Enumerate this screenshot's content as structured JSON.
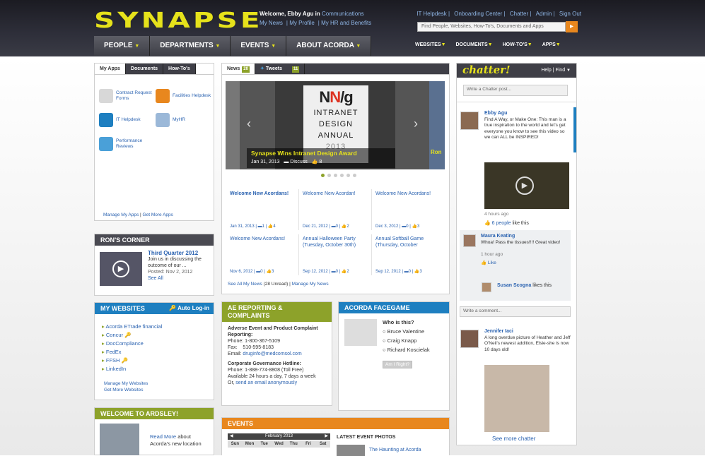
{
  "brand": {
    "logo": "SYNAPSE"
  },
  "header": {
    "welcome_prefix": "Welcome, Ebby Agu in",
    "department": "Communications",
    "user_links": [
      "My News",
      "My Profile",
      "My HR and Benefits"
    ],
    "top_links": [
      "IT Helpdesk",
      "Onboarding Center",
      "Chatter",
      "Admin",
      "Sign Out"
    ],
    "search_placeholder": "Find People, Websites, How-To's, Documents and Apps"
  },
  "main_nav": [
    "PEOPLE",
    "DEPARTMENTS",
    "EVENTS",
    "ABOUT ACORDA"
  ],
  "sub_nav": [
    "WEBSITES",
    "DOCUMENTS",
    "HOW-TO'S",
    "APPS"
  ],
  "apps": {
    "tabs": [
      "My Apps",
      "Documents",
      "How-To's"
    ],
    "items": [
      {
        "label": "Contract Request Forms",
        "icon": "contract-icon",
        "color": "#d8d8d8"
      },
      {
        "label": "Facilities Helpdesk",
        "icon": "facilities-icon",
        "color": "#e8871e"
      },
      {
        "label": "IT Helpdesk",
        "icon": "monitor-icon",
        "color": "#1e7fc0"
      },
      {
        "label": "MyHR",
        "icon": "person-icon",
        "color": "#9bb8d8"
      },
      {
        "label": "Performance Reviews",
        "icon": "review-icon",
        "color": "#4aa0d8"
      }
    ],
    "footer_manage": "Manage My Apps",
    "footer_more": "Get More Apps"
  },
  "news": {
    "tabs": [
      "News",
      "Tweets"
    ],
    "news_count": "20",
    "tweets_count": "11",
    "slide": {
      "logo_n": "N",
      "logo_slash": "N",
      "logo_g": "/g",
      "line1": "INTRANET",
      "line2": "DESIGN",
      "line3": "ANNUAL",
      "year": "2013",
      "caption_title": "Synapse Wins Intranet Design Award",
      "caption_date": "Jan 31, 2013",
      "caption_discuss": "Discuss",
      "caption_likes": "8",
      "side_label": "Ron"
    },
    "items": [
      {
        "title": "Welcome New Acordans!",
        "date": "Jan 31, 2013",
        "comments": "1",
        "likes": "4"
      },
      {
        "title": "Welcome New Acordan!",
        "date": "Dec 21, 2012",
        "comments": "0",
        "likes": "2"
      },
      {
        "title": "Welcome New Acordans!",
        "date": "Dec 3, 2012",
        "comments": "0",
        "likes": "3"
      },
      {
        "title": "Welcome New Acordans!",
        "date": "Nov 6, 2012",
        "comments": "0",
        "likes": "3"
      },
      {
        "title": "Annual Halloween Party (Tuesday, October 30th)",
        "date": "Sep 12, 2012",
        "comments": "0",
        "likes": "2"
      },
      {
        "title": "Annual Softball Game (Thursday, October",
        "date": "Sep 12, 2012",
        "comments": "0",
        "likes": "3"
      }
    ],
    "see_all": "See All My News",
    "unread": "(28 Unread)",
    "manage": "Manage My News"
  },
  "rons_corner": {
    "title": "RON'S CORNER",
    "post_title": "Third Quarter 2012",
    "post_text": "Join us in discussing the outcome of our ...",
    "posted": "Posted: Nov 2, 2012",
    "see_all": "See All"
  },
  "websites": {
    "title": "MY WEBSITES",
    "auto_login": "Auto Log-in",
    "items": [
      "Acorda ETrade financial",
      "Concur",
      "DocCompliance",
      "FedEx",
      "FFSH",
      "LinkedIn"
    ],
    "manage": "Manage My Websites",
    "more": "Get More Websites"
  },
  "welcome_ardsley": {
    "title": "WELCOME TO ARDSLEY!",
    "read_more": "Read More",
    "text": "about Acorda's new location"
  },
  "ae_reporting": {
    "title": "AE REPORTING & COMPLAINTS",
    "heading1": "Adverse Event and Product Complaint Reporting:",
    "phone_label": "Phone:",
    "phone": "1-800-367-5109",
    "fax_label": "Fax:",
    "fax": "510-595-8183",
    "email_label": "Email:",
    "email": "druginfo@medcomsol.com",
    "heading2": "Corporate Governance Hotline:",
    "phone2_label": "Phone:",
    "phone2": "1-888-774-8808 (Toll Free)",
    "availability": "Available 24 hours a day, 7 days a week",
    "or_text": "Or,",
    "anon": "send an email anonymously"
  },
  "facegame": {
    "title": "ACORDA FACEGAME",
    "question": "Who is this?",
    "options": [
      "Bruce Valentine",
      "Craig Knapp",
      "Richard Koscielak"
    ],
    "button": "Am I Right?"
  },
  "events": {
    "title": "EVENTS",
    "month": "February 2013",
    "days": [
      "Sun",
      "Mon",
      "Tue",
      "Wed",
      "Thu",
      "Fri",
      "Sat"
    ],
    "photos_title": "LATEST EVENT PHOTOS",
    "photo_caption": "The Haunting at Acorda"
  },
  "chatter": {
    "logo": "chatter!",
    "help": "Help",
    "find": "Find",
    "post_placeholder": "Write a Chatter post...",
    "posts": [
      {
        "name": "Ebby Agu",
        "text": "Find A Way, or Make One: This man is a true inspiration to the world and let's get everyone you know to see this video so we can ALL be INSPIRED!",
        "time": "4 hours ago",
        "likes": "6 people",
        "likes_suffix": "like this"
      },
      {
        "name": "Jennifer Iaci",
        "text": "A long overdue picture of Heather and Jeff O'Neil's newest addition, Elsie-she is now 10 days old!"
      }
    ],
    "comment": {
      "name": "Maura Keating",
      "text": "Whoa! Pass the tissues!!!! Great video!",
      "time": "1 hour ago",
      "like": "Like",
      "liker": "Susan Scogna",
      "liker_suffix": "likes this"
    },
    "comment_placeholder": "Write a comment...",
    "see_more": "See more chatter"
  }
}
